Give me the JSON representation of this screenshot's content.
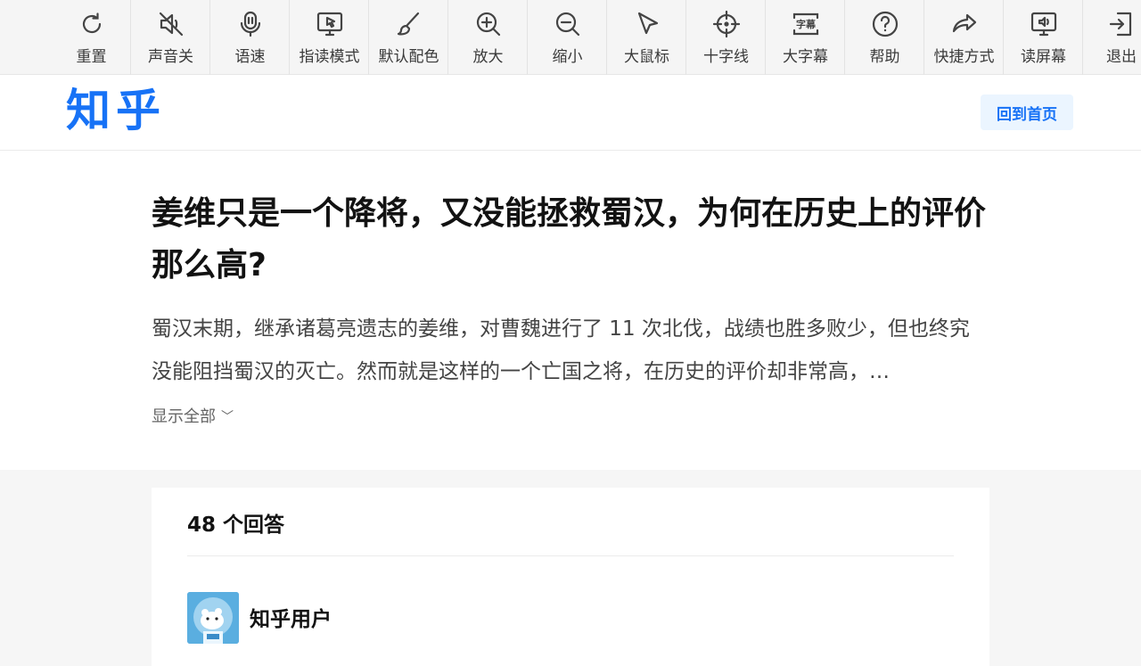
{
  "toolbar": {
    "items": [
      {
        "label": "重置",
        "icon": "reset-icon"
      },
      {
        "label": "声音关",
        "icon": "sound-off-icon"
      },
      {
        "label": "语速",
        "icon": "speech-rate-icon"
      },
      {
        "label": "指读模式",
        "icon": "point-read-icon"
      },
      {
        "label": "默认配色",
        "icon": "paint-brush-icon"
      },
      {
        "label": "放大",
        "icon": "zoom-in-icon"
      },
      {
        "label": "缩小",
        "icon": "zoom-out-icon"
      },
      {
        "label": "大鼠标",
        "icon": "big-cursor-icon"
      },
      {
        "label": "十字线",
        "icon": "crosshair-icon"
      },
      {
        "label": "大字幕",
        "icon": "caption-icon"
      },
      {
        "label": "帮助",
        "icon": "help-icon"
      },
      {
        "label": "快捷方式",
        "icon": "shortcut-icon"
      },
      {
        "label": "读屏幕",
        "icon": "screen-reader-icon"
      },
      {
        "label": "退出",
        "icon": "exit-icon"
      }
    ],
    "caption_icon_text": "字幕"
  },
  "header": {
    "logo": "知乎",
    "home_button": "回到首页"
  },
  "question": {
    "title": "姜维只是一个降将，又没能拯救蜀汉，为何在历史上的评价那么高?",
    "excerpt": "蜀汉末期，继承诸葛亮遗志的姜维，对曹魏进行了 11 次北伐，战绩也胜多败少，但也终究没能阻挡蜀汉的灭亡。然而就是这样的一个亡国之将，在历史的评价却非常高，…",
    "show_all": "显示全部",
    "show_all_chevron": "﹀"
  },
  "answers": {
    "count_label": "48 个回答",
    "first_author": "知乎用户"
  },
  "colors": {
    "brand": "#1772f6",
    "brand_light": "#ebf5ff",
    "toolbar_bg": "#f5f5f5",
    "page_bg": "#f6f6f6"
  }
}
